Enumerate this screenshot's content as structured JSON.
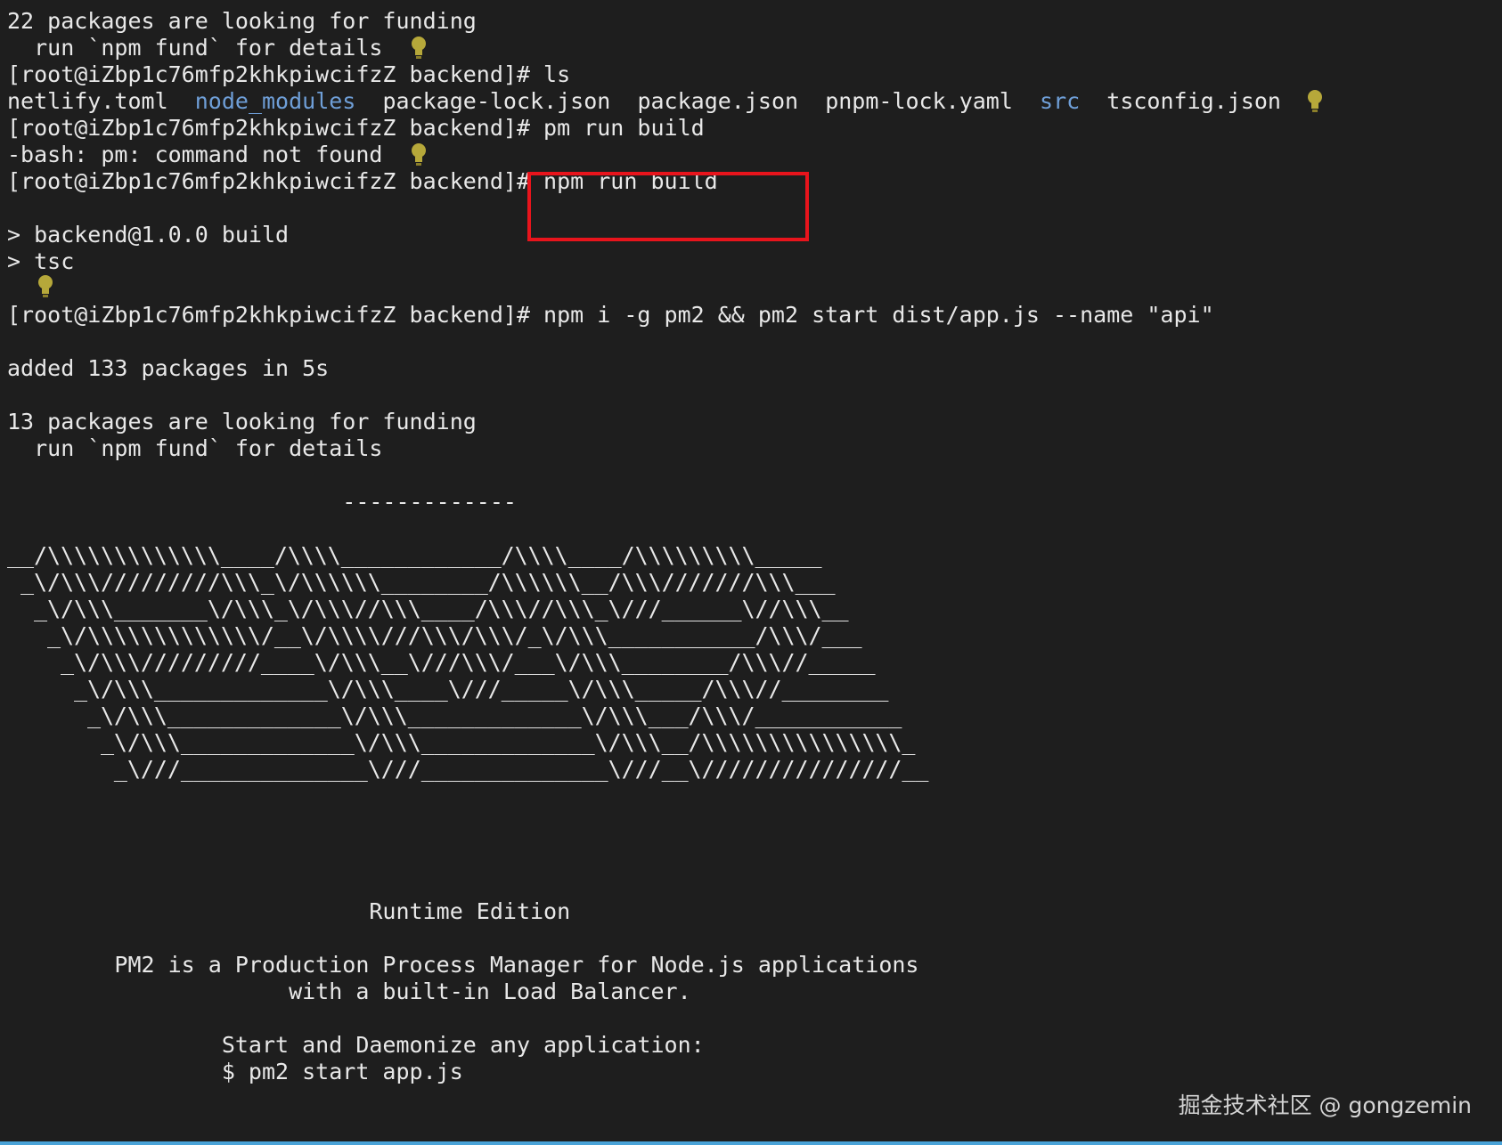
{
  "colors": {
    "background": "#1e1e1e",
    "text": "#e8e8e8",
    "directory": "#6f9fd8",
    "highlight": "#e8141c",
    "bulb": "#b6a83a"
  },
  "terminal": {
    "funding1": "22 packages are looking for funding",
    "fund_details1": "  run `npm fund` for details",
    "prompt1": "[root@iZbp1c76mfp2khkpiwcifzZ backend]# ls",
    "listing": {
      "f1": "netlify.toml",
      "d1": "node_modules",
      "f2": "package-lock.json",
      "f3": "package.json",
      "f4": "pnpm-lock.yaml",
      "d2": "src",
      "f5": "tsconfig.json"
    },
    "prompt2": "[root@iZbp1c76mfp2khkpiwcifzZ backend]# pm run build",
    "error": "-bash: pm: command not found",
    "prompt3": "[root@iZbp1c76mfp2khkpiwcifzZ backend]# npm run build",
    "build_script": "> backend@1.0.0 build",
    "tsc": "> tsc",
    "prompt4": "[root@iZbp1c76mfp2khkpiwcifzZ backend]# npm i -g pm2 && pm2 start dist/app.js --name \"api\"",
    "added": "added 133 packages in 5s",
    "funding2": "13 packages are looking for funding",
    "fund_details2": "  run `npm fund` for details",
    "separator": "                         -------------",
    "ascii_art": [
      "__/\\\\\\\\\\\\\\\\\\\\\\\\\\____/\\\\\\\\____________/\\\\\\\\____/\\\\\\\\\\\\\\\\\\_____",
      " _\\/\\\\\\/////////\\\\\\_\\/\\\\\\\\\\\\________/\\\\\\\\\\\\__/\\\\\\///////\\\\\\___",
      "  _\\/\\\\\\_______\\/\\\\\\_\\/\\\\\\//\\\\\\____/\\\\\\//\\\\\\_\\///______\\//\\\\\\__",
      "   _\\/\\\\\\\\\\\\\\\\\\\\\\\\\\/__\\/\\\\\\\\///\\\\\\/\\\\\\/_\\/\\\\\\___________/\\\\\\/___",
      "    _\\/\\\\\\/////////____\\/\\\\\\__\\///\\\\\\/___\\/\\\\\\________/\\\\\\//_____",
      "     _\\/\\\\\\_____________\\/\\\\\\____\\///_____\\/\\\\\\_____/\\\\\\//________",
      "      _\\/\\\\\\_____________\\/\\\\\\_____________\\/\\\\\\___/\\\\\\/___________",
      "       _\\/\\\\\\_____________\\/\\\\\\_____________\\/\\\\\\__/\\\\\\\\\\\\\\\\\\\\\\\\\\\\\\_",
      "        _\\///______________\\///______________\\///__\\///////////////__"
    ],
    "runtime_edition": "                           Runtime Edition",
    "pm2_desc1": "        PM2 is a Production Process Manager for Node.js applications",
    "pm2_desc2": "                     with a built-in Load Balancer.",
    "start_title": "                Start and Daemonize any application:",
    "start_cmd": "                $ pm2 start app.js"
  },
  "watermark": "掘金技术社区 @ gongzemin",
  "icons": {
    "bulb": "lightbulb-icon"
  }
}
